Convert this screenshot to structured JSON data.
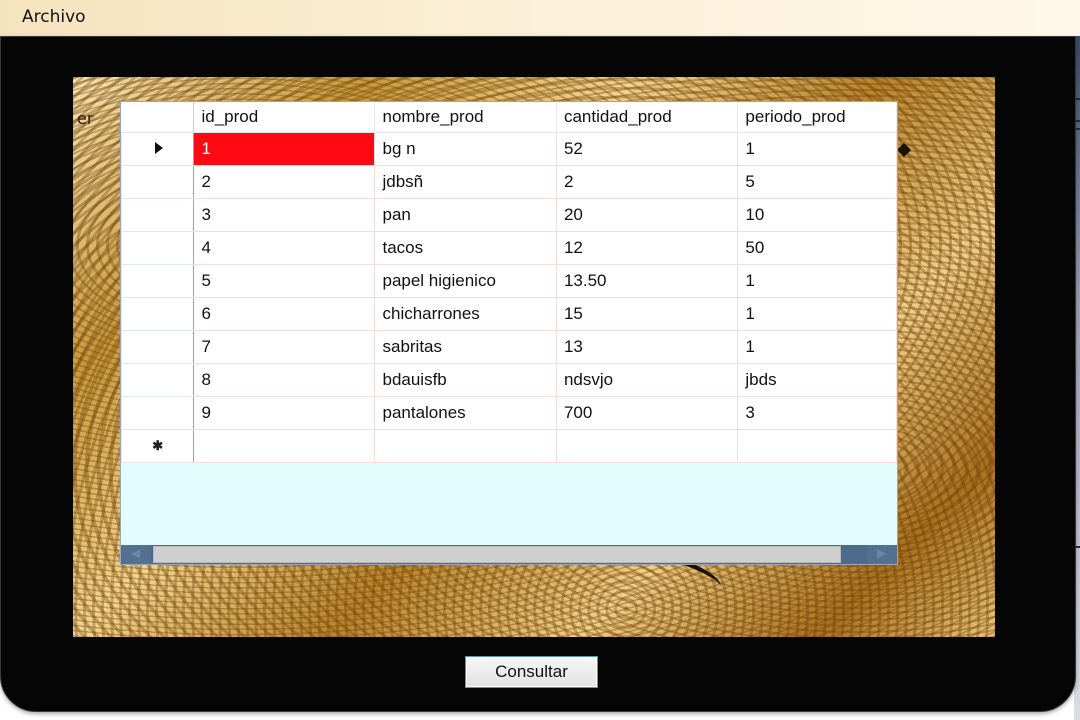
{
  "menu": {
    "archivo": "Archivo"
  },
  "background": {
    "partial_text": "er"
  },
  "grid": {
    "columns": [
      "id_prod",
      "nombre_prod",
      "cantidad_prod",
      "periodo_prod"
    ],
    "rows": [
      [
        "1",
        "bg n",
        "52",
        "1"
      ],
      [
        "2",
        "jdbsñ",
        "2",
        "5"
      ],
      [
        "3",
        "pan",
        "20",
        "10"
      ],
      [
        "4",
        "tacos",
        "12",
        "50"
      ],
      [
        "5",
        "papel higienico",
        "13.50",
        "1"
      ],
      [
        "6",
        "chicharrones",
        "15",
        "1"
      ],
      [
        "7",
        "sabritas",
        "13",
        "1"
      ],
      [
        "8",
        "bdauisfb",
        "ndsvjo",
        "jbds"
      ],
      [
        "9",
        "pantalones",
        "700",
        "3"
      ]
    ],
    "selected_cell_color": "#ff0a14",
    "empty_area_color": "#e1fdfd",
    "current_row_icon": "row-pointer-arrow-icon",
    "new_row_icon": "new-row-asterisk-icon"
  },
  "buttons": {
    "consultar": "Consultar"
  }
}
